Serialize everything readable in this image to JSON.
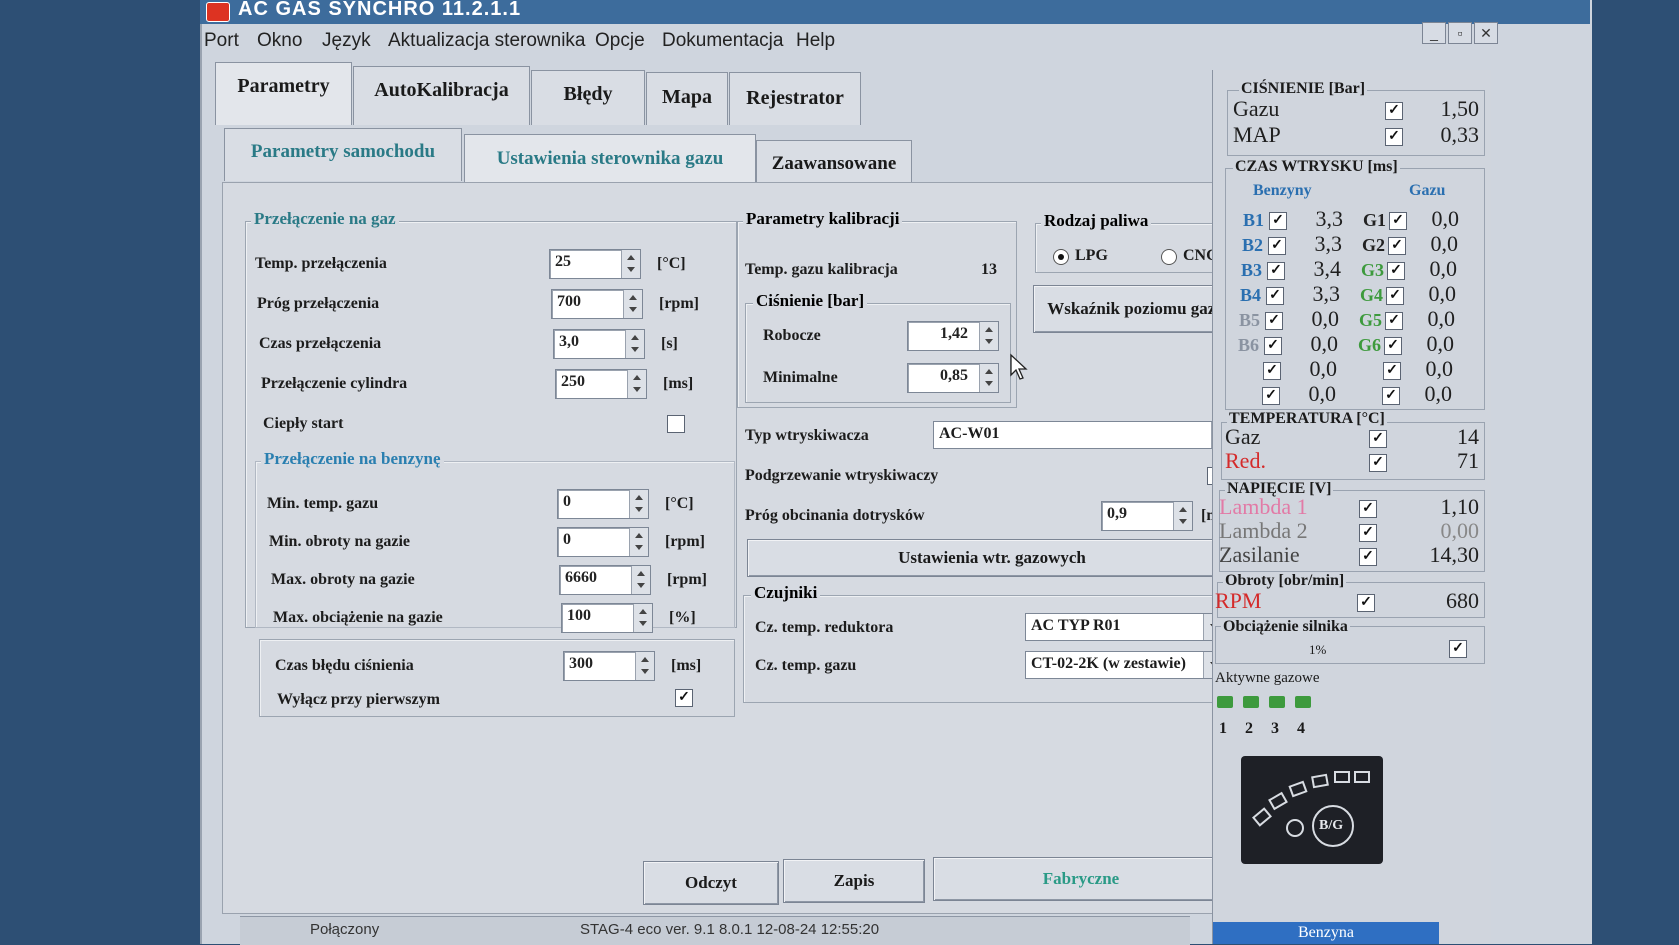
{
  "window": {
    "title": "AC GAS SYNCHRO  11.2.1.1"
  },
  "menu": [
    "Port",
    "Okno",
    "Język",
    "Aktualizacja sterownika",
    "Opcje",
    "Dokumentacja",
    "Help"
  ],
  "main_tabs": [
    "Parametry",
    "AutoKalibracja",
    "Błędy",
    "Mapa",
    "Rejestrator"
  ],
  "sub_tabs": [
    "Parametry samochodu",
    "Ustawienia sterownika gazu",
    "Zaawansowane"
  ],
  "switch_to_gas": {
    "title": "Przełączenie na gaz",
    "rows": [
      {
        "label": "Temp. przełączenia",
        "value": "25",
        "unit": "[°C]"
      },
      {
        "label": "Próg przełączenia",
        "value": "700",
        "unit": "[rpm]"
      },
      {
        "label": "Czas przełączenia",
        "value": "3,0",
        "unit": "[s]"
      },
      {
        "label": "Przełączenie cylindra",
        "value": "250",
        "unit": "[ms]"
      }
    ],
    "warm_start": "Ciepły start"
  },
  "switch_to_petrol": {
    "title": "Przełączenie na benzynę",
    "rows": [
      {
        "label": "Min. temp. gazu",
        "value": "0",
        "unit": "[°C]"
      },
      {
        "label": "Min. obroty na gazie",
        "value": "0",
        "unit": "[rpm]"
      },
      {
        "label": "Max. obroty na gazie",
        "value": "6660",
        "unit": "[rpm]"
      },
      {
        "label": "Max. obciążenie na gazie",
        "value": "100",
        "unit": "[%]"
      }
    ],
    "pressure_error_label": "Czas błędu ciśnienia",
    "pressure_error_value": "300",
    "pressure_error_unit": "[ms]",
    "disable_first": "Wyłącz przy pierwszym"
  },
  "calibration": {
    "title": "Parametry kalibracji",
    "gas_temp_label": "Temp. gazu kalibracja",
    "gas_temp_value": "13",
    "pressure_title": "Ciśnienie [bar]",
    "working_label": "Robocze",
    "working_value": "1,42",
    "minimal_label": "Minimalne",
    "minimal_value": "0,85"
  },
  "fuel_type": {
    "title": "Rodzaj paliwa",
    "lpg": "LPG",
    "cng": "CNG"
  },
  "gas_level_button": "Wskaźnik poziomu gazu",
  "injector": {
    "type_label": "Typ wtryskiwacza",
    "type_value": "AC-W01",
    "heating_label": "Podgrzewanie wtryskiwaczy",
    "cutoff_label": "Próg obcinania dotrysków",
    "cutoff_value": "0,9",
    "cutoff_unit": "[ms]",
    "settings_button": "Ustawienia wtr. gazowych"
  },
  "sensors": {
    "title": "Czujniki",
    "reducer_label": "Cz. temp. reduktora",
    "reducer_value": "AC TYP R01",
    "gas_label": "Cz. temp. gazu",
    "gas_value": "CT-02-2K (w zestawie)"
  },
  "footer_buttons": {
    "read": "Odczyt",
    "write": "Zapis",
    "factory": "Fabryczne"
  },
  "status_bar": {
    "connection": "Połączony",
    "device": "STAG-4 eco   ver. 9.1  8.0.1    12-08-24 12:55:20"
  },
  "right_panel": {
    "pressure_title": "CIŚNIENIE [Bar]",
    "pressure": [
      {
        "label": "Gazu",
        "value": "1,50"
      },
      {
        "label": "MAP",
        "value": "0,33"
      }
    ],
    "injection_title": "CZAS WTRYSKU [ms]",
    "petrol_header": "Benzyny",
    "gas_header": "Gazu",
    "injection": [
      {
        "b": "B1",
        "bv": "3,3",
        "g": "G1",
        "gv": "0,0"
      },
      {
        "b": "B2",
        "bv": "3,3",
        "g": "G2",
        "gv": "0,0"
      },
      {
        "b": "B3",
        "bv": "3,4",
        "g": "G3",
        "gv": "0,0"
      },
      {
        "b": "B4",
        "bv": "3,3",
        "g": "G4",
        "gv": "0,0"
      },
      {
        "b": "B5",
        "bv": "0,0",
        "g": "G5",
        "gv": "0,0"
      },
      {
        "b": "B6",
        "bv": "0,0",
        "g": "G6",
        "gv": "0,0"
      },
      {
        "b": "",
        "bv": "0,0",
        "g": "",
        "gv": "0,0"
      },
      {
        "b": "",
        "bv": "0,0",
        "g": "",
        "gv": "0,0"
      }
    ],
    "temperature_title": "TEMPERATURA [°C]",
    "temperature": [
      {
        "label": "Gaz",
        "value": "14"
      },
      {
        "label": "Red.",
        "value": "71"
      }
    ],
    "voltage_title": "NAPIĘCIE [V]",
    "voltage": [
      {
        "label": "Lambda 1",
        "value": "1,10"
      },
      {
        "label": "Lambda 2",
        "value": "0,00"
      },
      {
        "label": "Zasilanie",
        "value": "14,30"
      }
    ],
    "rpm_title": "Obroty [obr/min]",
    "rpm_label": "RPM",
    "rpm_value": "680",
    "load_title": "Obciążenie silnika",
    "load_value": "1%",
    "active_gas_title": "Aktywne gazowe",
    "active_gas": [
      "1",
      "2",
      "3",
      "4"
    ],
    "logo_text": "B/G",
    "mode": "Benzyna",
    "colors": {
      "red": "#d42a2a",
      "pink": "#e27aa6",
      "green": "#3d9a3d",
      "mode_bar": "#2f6fc2",
      "teal": "#2a7a86"
    }
  }
}
